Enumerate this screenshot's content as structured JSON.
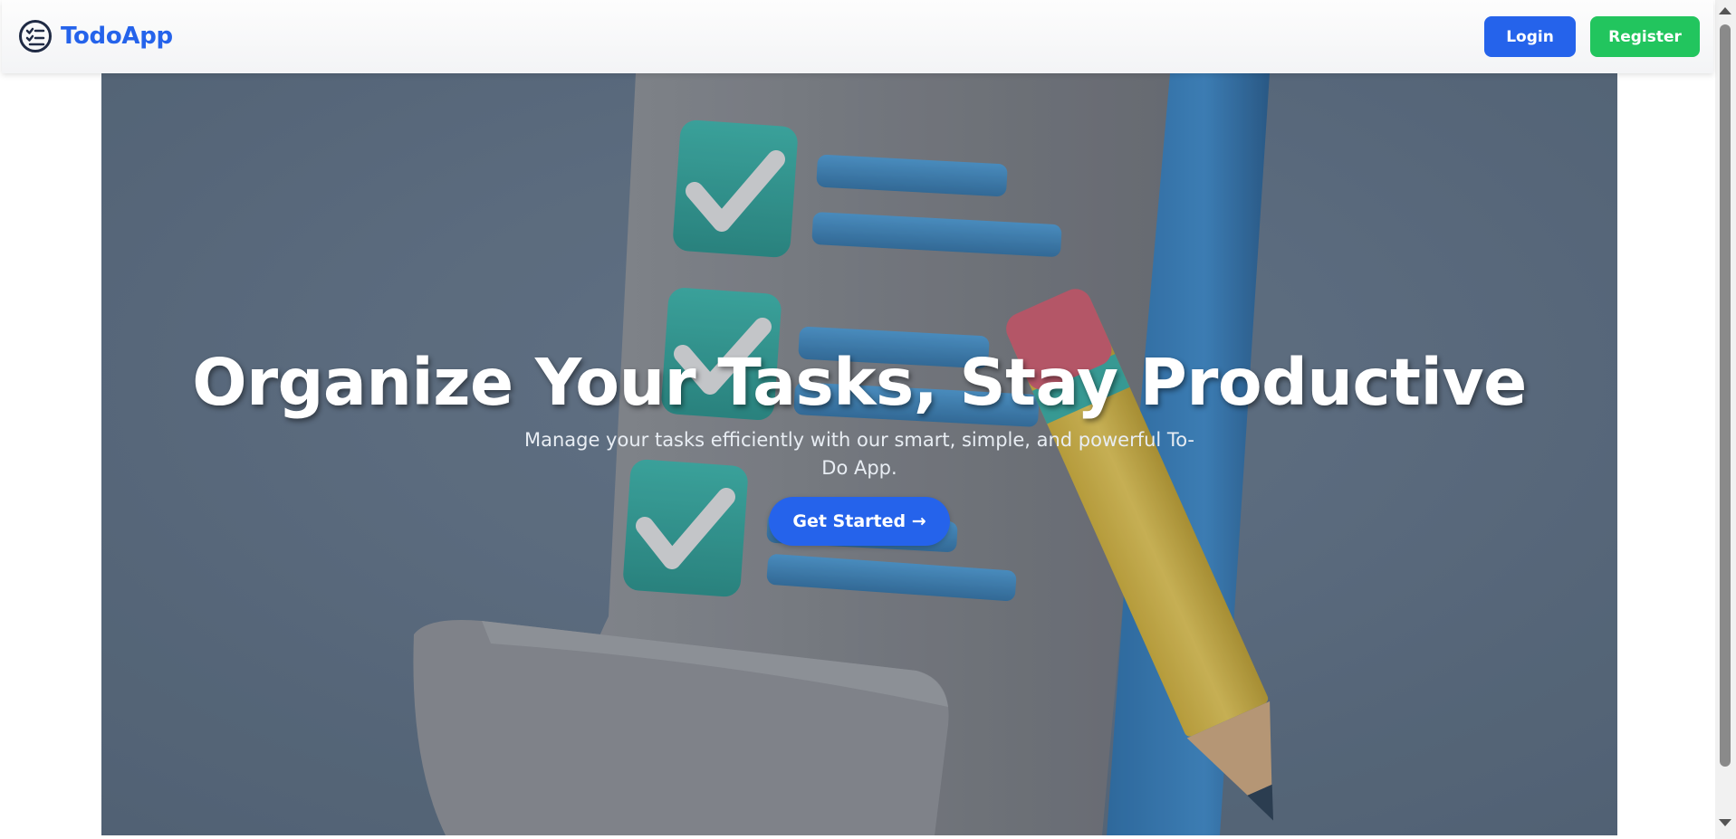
{
  "navbar": {
    "brand_name": "TodoApp",
    "brand_icon": "checklist-icon",
    "login_label": "Login",
    "register_label": "Register"
  },
  "hero": {
    "title": "Organize Your Tasks, Stay Productive",
    "subtitle": "Manage your tasks efficiently with our smart, simple, and powerful To-Do App.",
    "cta_label": "Get Started →",
    "illustration": "checklist-with-pencil-illustration"
  },
  "colors": {
    "brand_blue": "#2563eb",
    "register_green": "#22c55e",
    "hero_bg": "#5b6b7d",
    "checkbox_teal": "#37a99f",
    "pencil_yellow": "#d7b845"
  }
}
